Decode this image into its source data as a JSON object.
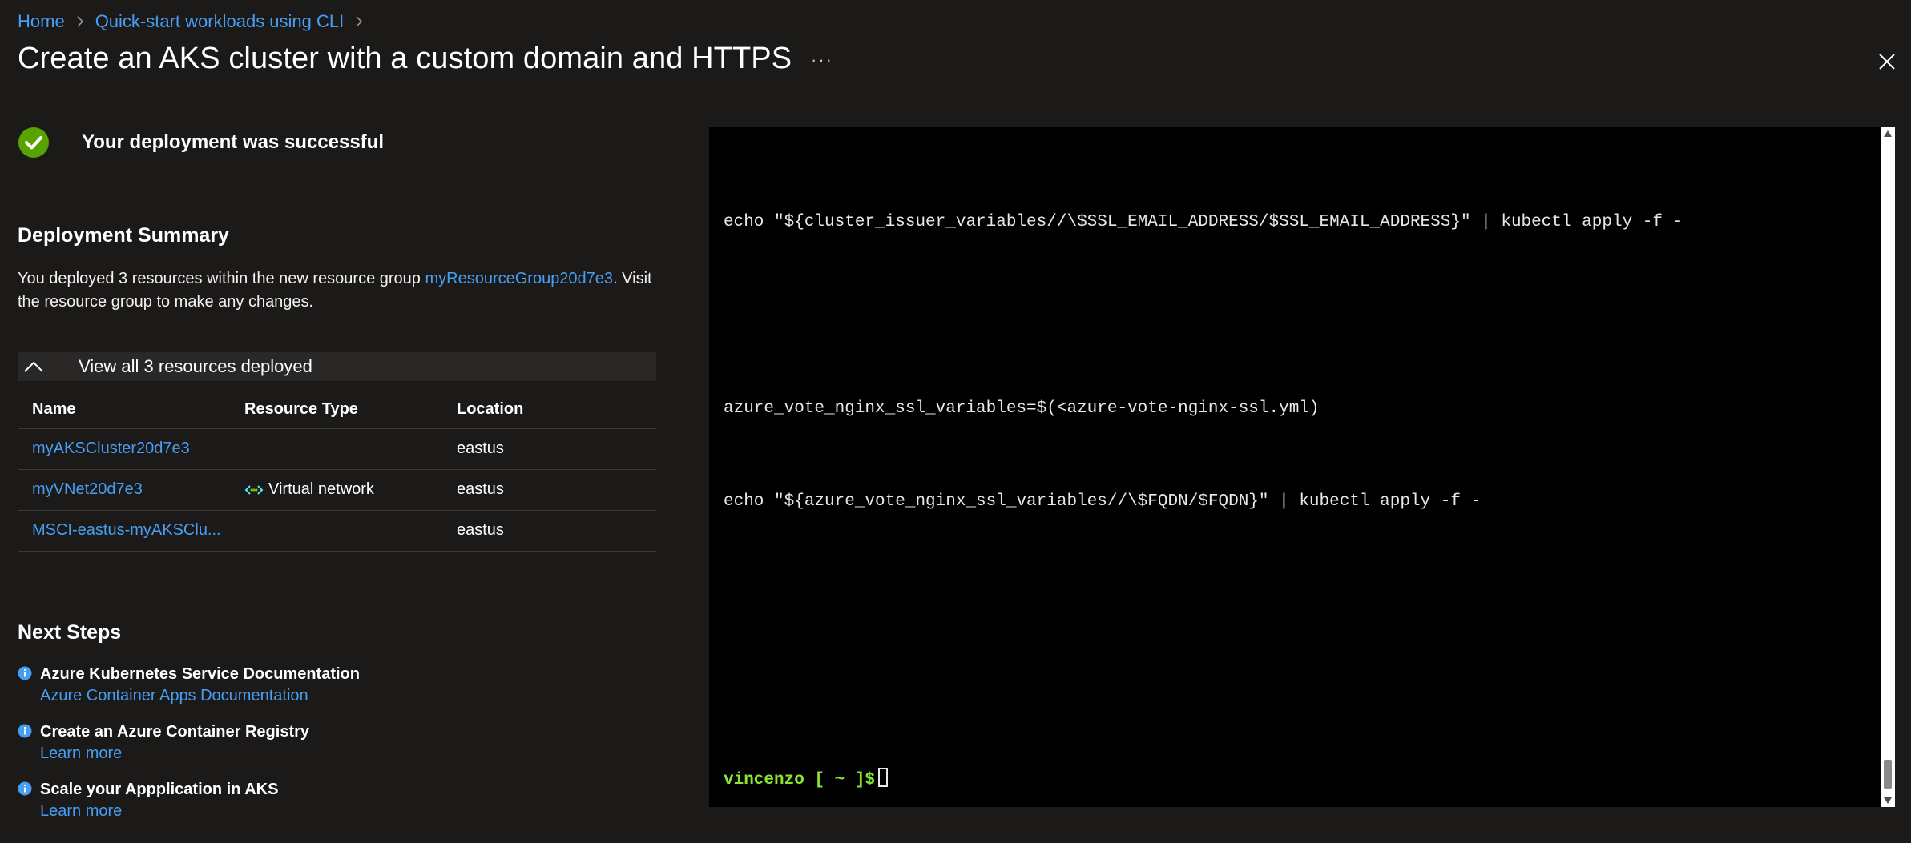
{
  "breadcrumb": {
    "items": [
      "Home",
      "Quick-start workloads using CLI"
    ]
  },
  "header": {
    "title": "Create an AKS cluster with a custom domain and HTTPS",
    "more_label": "···"
  },
  "deployment": {
    "status_text": "Your deployment was successful"
  },
  "summary": {
    "title": "Deployment Summary",
    "text_before": "You deployed 3 resources within the new resource group ",
    "resource_group": "myResourceGroup20d7e3",
    "text_after": ". Visit the resource group to make any changes."
  },
  "resources": {
    "toggle_label": "View all 3 resources deployed",
    "columns": [
      "Name",
      "Resource Type",
      "Location"
    ],
    "rows": [
      {
        "name": "myAKSCluster20d7e3",
        "type": "",
        "location": "eastus"
      },
      {
        "name": "myVNet20d7e3",
        "type": "Virtual network",
        "location": "eastus"
      },
      {
        "name": "MSCI-eastus-myAKSClu...",
        "type": "",
        "location": "eastus"
      }
    ]
  },
  "next_steps": {
    "title": "Next Steps",
    "items": [
      {
        "title": "Azure Kubernetes Service Documentation",
        "link": "Azure Container Apps Documentation"
      },
      {
        "title": "Create an Azure Container Registry",
        "link": "Learn more"
      },
      {
        "title": "Scale your Appplication in AKS",
        "link": "Learn more"
      }
    ]
  },
  "terminal": {
    "lines": [
      "echo \"${cluster_issuer_variables//\\$SSL_EMAIL_ADDRESS/$SSL_EMAIL_ADDRESS}\" | kubectl apply -f -",
      "azure_vote_nginx_ssl_variables=$(<azure-vote-nginx-ssl.yml)",
      "echo \"${azure_vote_nginx_ssl_variables//\\$FQDN/$FQDN}\" | kubectl apply -f -"
    ],
    "prompt": "vincenzo [ ~ ]$"
  },
  "colors": {
    "background": "#1b1a19",
    "link": "#479ef5",
    "success": "#57a300",
    "prompt": "#8ae234"
  }
}
